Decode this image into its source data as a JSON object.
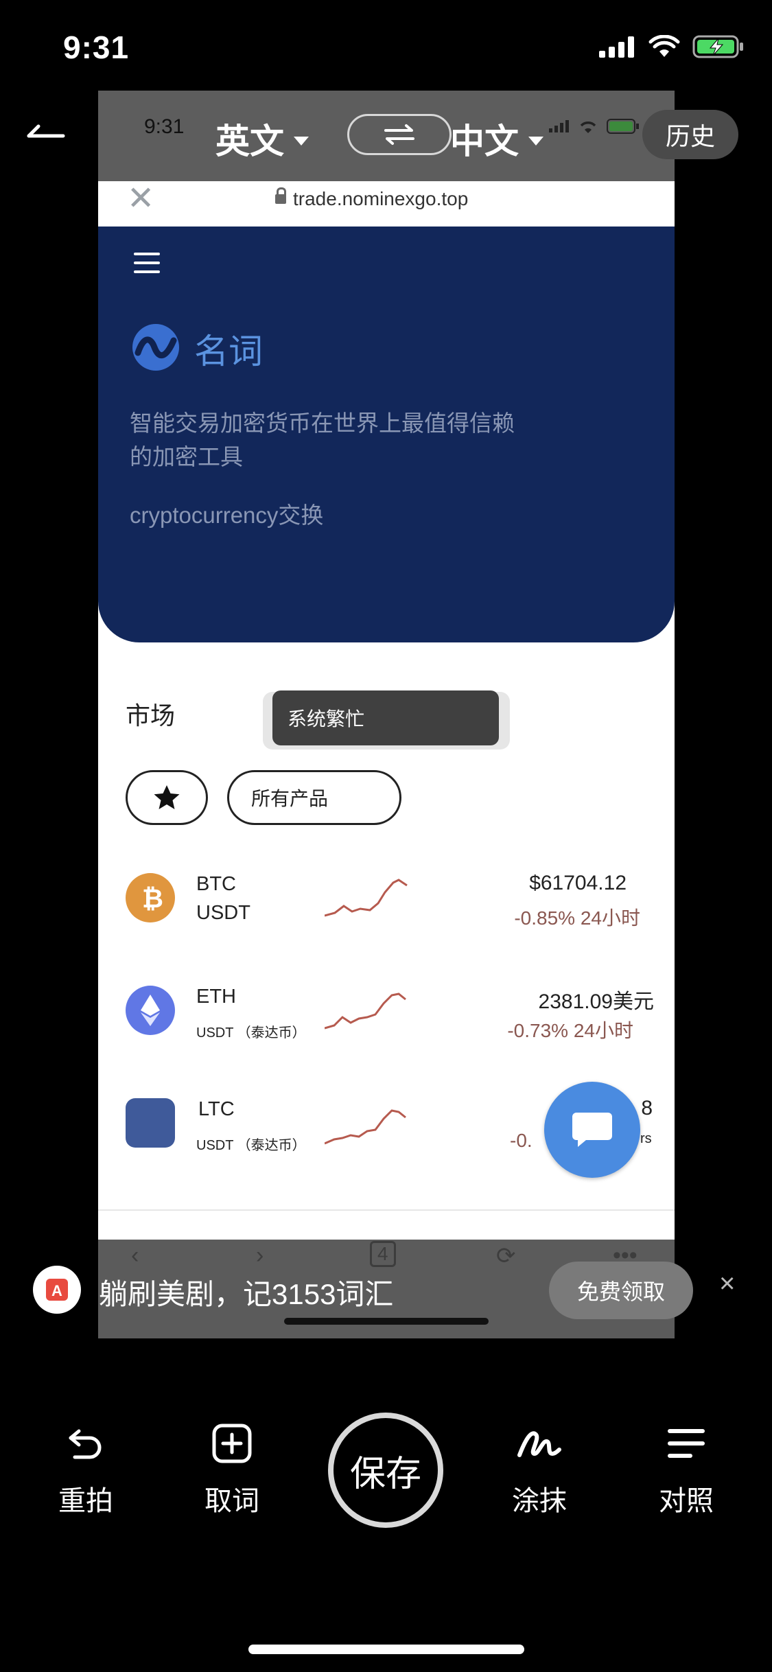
{
  "status_bar": {
    "time": "9:31"
  },
  "translate_header": {
    "inner_time": "9:31",
    "source_lang": "英文",
    "target_lang": "中文",
    "history_label": "历史"
  },
  "browser": {
    "url": "trade.nominexgo.top",
    "close_glyph": "✕"
  },
  "hero": {
    "brand": "名词",
    "tagline": "智能交易加密货币在世界上最值得信赖的加密工具",
    "subtitle": "cryptocurrency交换"
  },
  "market": {
    "label": "市场",
    "toast": "系统繁忙",
    "filter_all": "所有产品",
    "coins": [
      {
        "base": "BTC",
        "quote": "USDT",
        "price": "$61704.12",
        "change": "-0.85% 24小时",
        "color": "#e0963e",
        "icon": "bitcoin-icon"
      },
      {
        "base": "ETH",
        "quote": "USDT （泰达币）",
        "price": "2381.09美元",
        "change": "-0.73% 24小时",
        "color": "#6077e5",
        "icon": "ethereum-icon"
      },
      {
        "base": "LTC",
        "quote": "USDT （泰达币）",
        "price": "8",
        "change": "-0.",
        "color": "#3f5a9a",
        "icon": "litecoin-icon",
        "price_suffix": "rs"
      }
    ]
  },
  "browser_nav": {
    "tab_count": "4"
  },
  "ad": {
    "text": "躺刷美剧，记3153词汇",
    "button": "免费领取",
    "close": "×"
  },
  "toolbar": {
    "retake": "重拍",
    "pick_word": "取词",
    "save": "保存",
    "smear": "涂抹",
    "compare": "对照"
  },
  "colors": {
    "hero_bg": "#12275a",
    "accent_blue": "#4a8be0",
    "negative_change": "#8a5750",
    "sparkline": "#b65a4e"
  }
}
